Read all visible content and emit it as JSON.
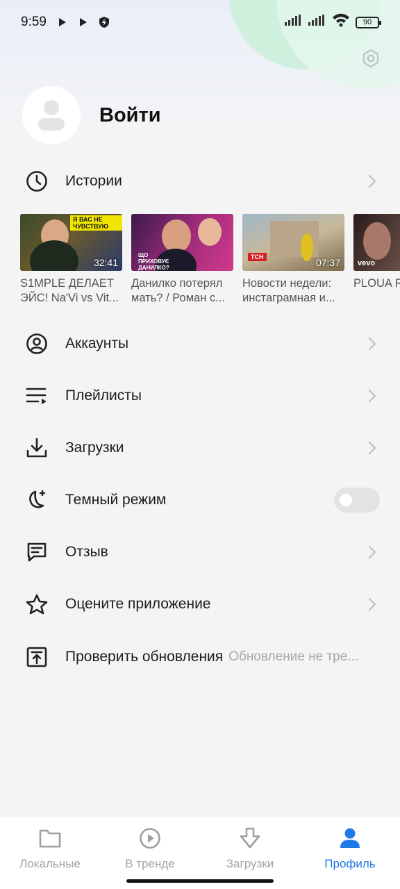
{
  "status_bar": {
    "time": "9:59",
    "battery": "90"
  },
  "profile": {
    "login_label": "Войти"
  },
  "menu": {
    "history": "Истории",
    "accounts": "Аккаунты",
    "playlists": "Плейлисты",
    "downloads": "Загрузки",
    "dark_mode": "Темный режим",
    "dark_mode_enabled": false,
    "feedback": "Отзыв",
    "rate_app": "Оцените приложение",
    "check_updates": "Проверить обновления",
    "check_updates_status": "Обновление не тре..."
  },
  "history_videos": [
    {
      "title": "S1MPLE ДЕЛАЕТ ЭЙС! Na'Vi vs Vit...",
      "duration": "32:41",
      "thumb_text": "Я ВАС НЕ ЧУВСТВУЮ"
    },
    {
      "title": "Данилко потерял мать? / Роман с...",
      "duration": "",
      "thumb_text": "ЩО ПРИХОВУЄ ДАНИЛКО?"
    },
    {
      "title": "Новости недели: инстаграмная и...",
      "duration": "07:37",
      "thumb_text": "ТСН"
    },
    {
      "title": "PLOUA R PANZER",
      "duration": "",
      "thumb_text": "vevo"
    }
  ],
  "bottom_nav": {
    "local": "Локальные",
    "trending": "В тренде",
    "downloads": "Загрузки",
    "profile": "Профиль",
    "active": "profile"
  },
  "colors": {
    "accent": "#1e78e6",
    "inactive": "#a3a3a3",
    "background": "#f4f4f4"
  }
}
